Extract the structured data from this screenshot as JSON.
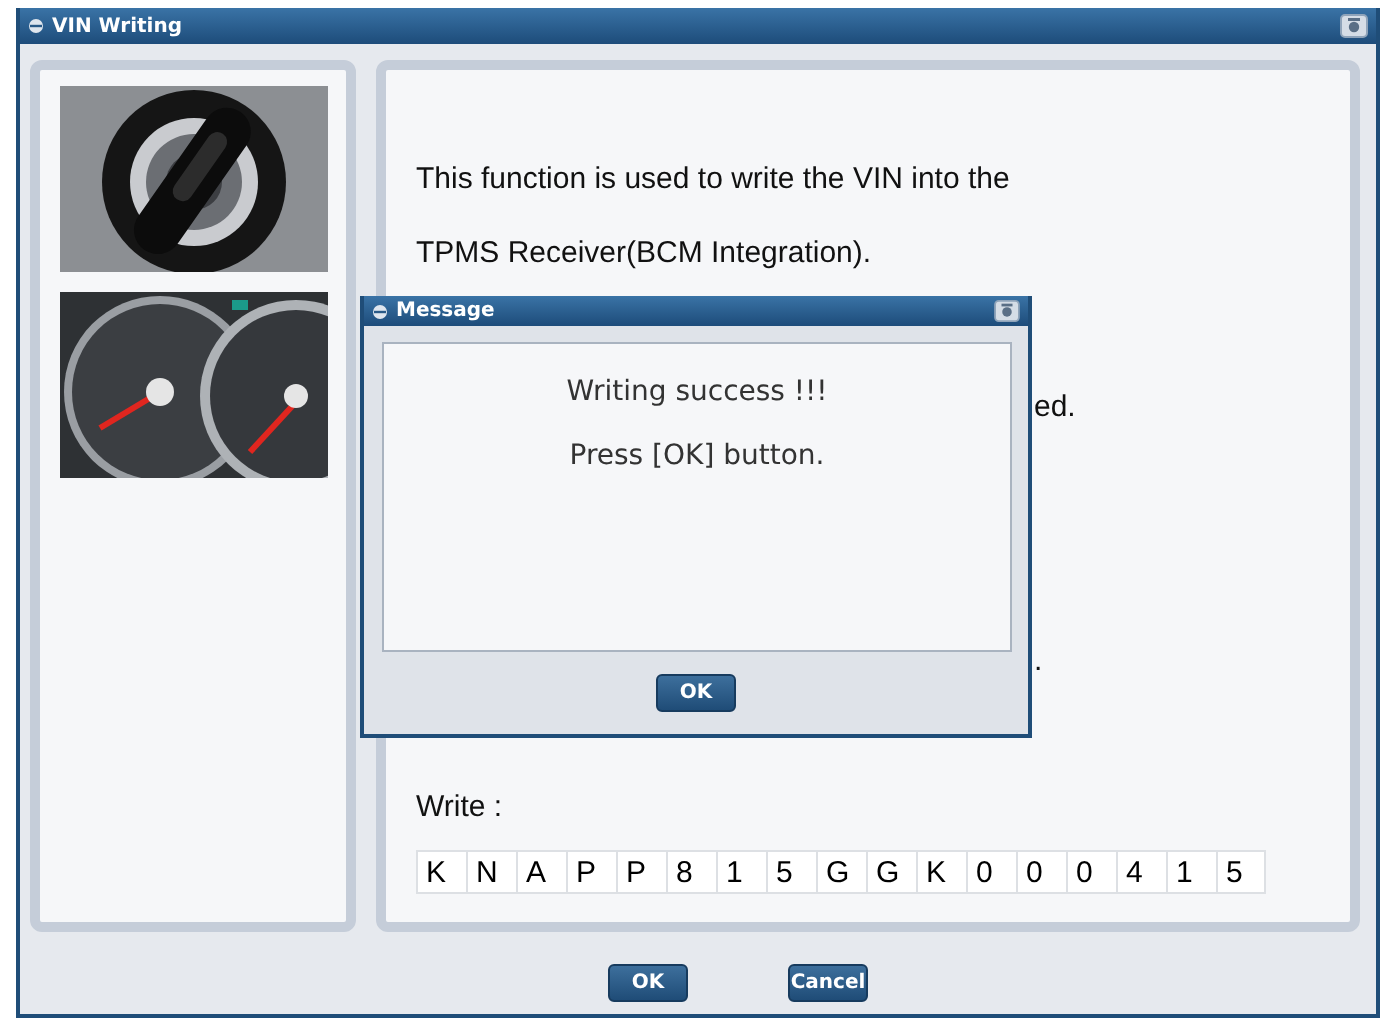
{
  "window": {
    "title": "VIN Writing"
  },
  "description": {
    "lines": [
      "This function is used to write the VIN into the",
      "TPMS Receiver(BCM Integration)."
    ],
    "covered_fragments": [
      "ed.",
      "."
    ]
  },
  "write": {
    "label": "Write :",
    "vin": [
      "K",
      "N",
      "A",
      "P",
      "P",
      "8",
      "1",
      "5",
      "G",
      "G",
      "K",
      "0",
      "0",
      "0",
      "4",
      "1",
      "5"
    ]
  },
  "buttons": [
    {
      "label": "OK"
    },
    {
      "label": "Cancel"
    }
  ],
  "message_dialog": {
    "title": "Message",
    "lines": [
      "Writing success !!!",
      "Press [OK] button."
    ],
    "button": "OK"
  }
}
